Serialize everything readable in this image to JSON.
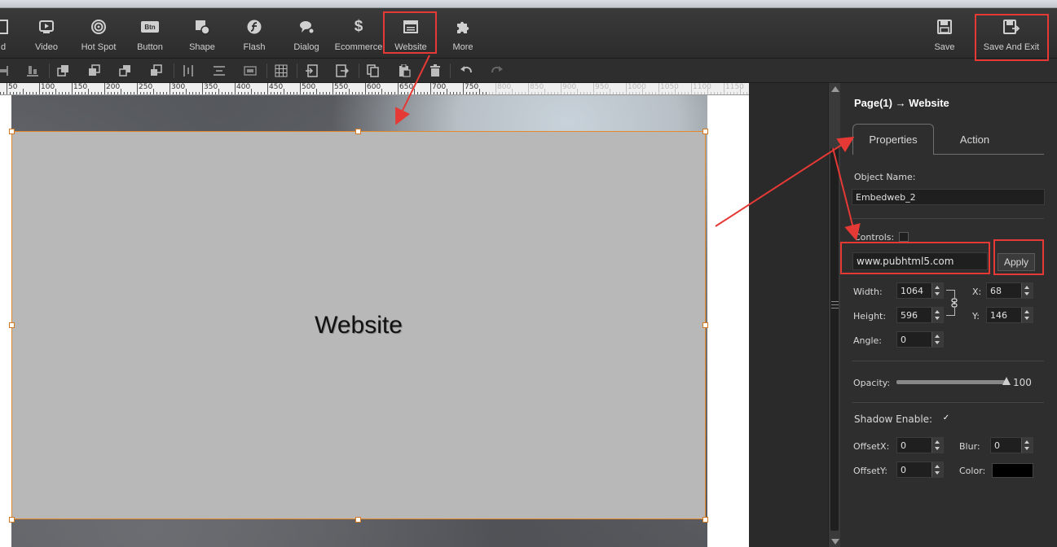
{
  "toolbar": {
    "items": [
      {
        "label": "d",
        "icon": "load-icon"
      },
      {
        "label": "Video",
        "icon": "video-icon"
      },
      {
        "label": "Hot Spot",
        "icon": "hotspot-icon"
      },
      {
        "label": "Button",
        "icon": "button-icon"
      },
      {
        "label": "Shape",
        "icon": "shape-icon"
      },
      {
        "label": "Flash",
        "icon": "flash-icon"
      },
      {
        "label": "Dialog",
        "icon": "dialog-icon"
      },
      {
        "label": "Ecommerce",
        "icon": "dollar-icon"
      },
      {
        "label": "Website",
        "icon": "website-icon"
      },
      {
        "label": "More",
        "icon": "puzzle-icon"
      }
    ],
    "save_label": "Save",
    "save_exit_label": "Save And Exit",
    "btn_glyph": "Btn",
    "dollar_glyph": "$"
  },
  "ruler": {
    "labels": [
      "50",
      "100",
      "150",
      "200",
      "250",
      "300",
      "350",
      "400",
      "450",
      "500",
      "550",
      "600",
      "650",
      "700",
      "750",
      "800",
      "850",
      "900",
      "950",
      "1000",
      "1050",
      "1100",
      "1150"
    ]
  },
  "canvas": {
    "object_label": "Website"
  },
  "panel": {
    "breadcrumb": "Page(1) → Website",
    "tabs": [
      "Properties",
      "Action"
    ],
    "active_tab": "Properties",
    "object_name_label": "Object Name:",
    "object_name_value": "Embedweb_2",
    "controls_label": "Controls:",
    "url_value": "www.pubhtml5.com",
    "apply_label": "Apply",
    "width_label": "Width:",
    "width_value": "1064",
    "height_label": "Height:",
    "height_value": "596",
    "x_label": "X:",
    "x_value": "68",
    "y_label": "Y:",
    "y_value": "146",
    "angle_label": "Angle:",
    "angle_value": "0",
    "opacity_label": "Opacity:",
    "opacity_value": "100",
    "shadow_label": "Shadow Enable:",
    "shadow_checked": "✓",
    "offsetx_label": "OffsetX:",
    "offsetx_value": "0",
    "blur_label": "Blur:",
    "blur_value": "0",
    "offsety_label": "OffsetY:",
    "offsety_value": "0",
    "color_label": "Color:",
    "shadow_color": "#000000"
  },
  "colors": {
    "highlight": "#e53935",
    "selection": "#e58a2a",
    "panel_bg": "#2e2e2e"
  }
}
